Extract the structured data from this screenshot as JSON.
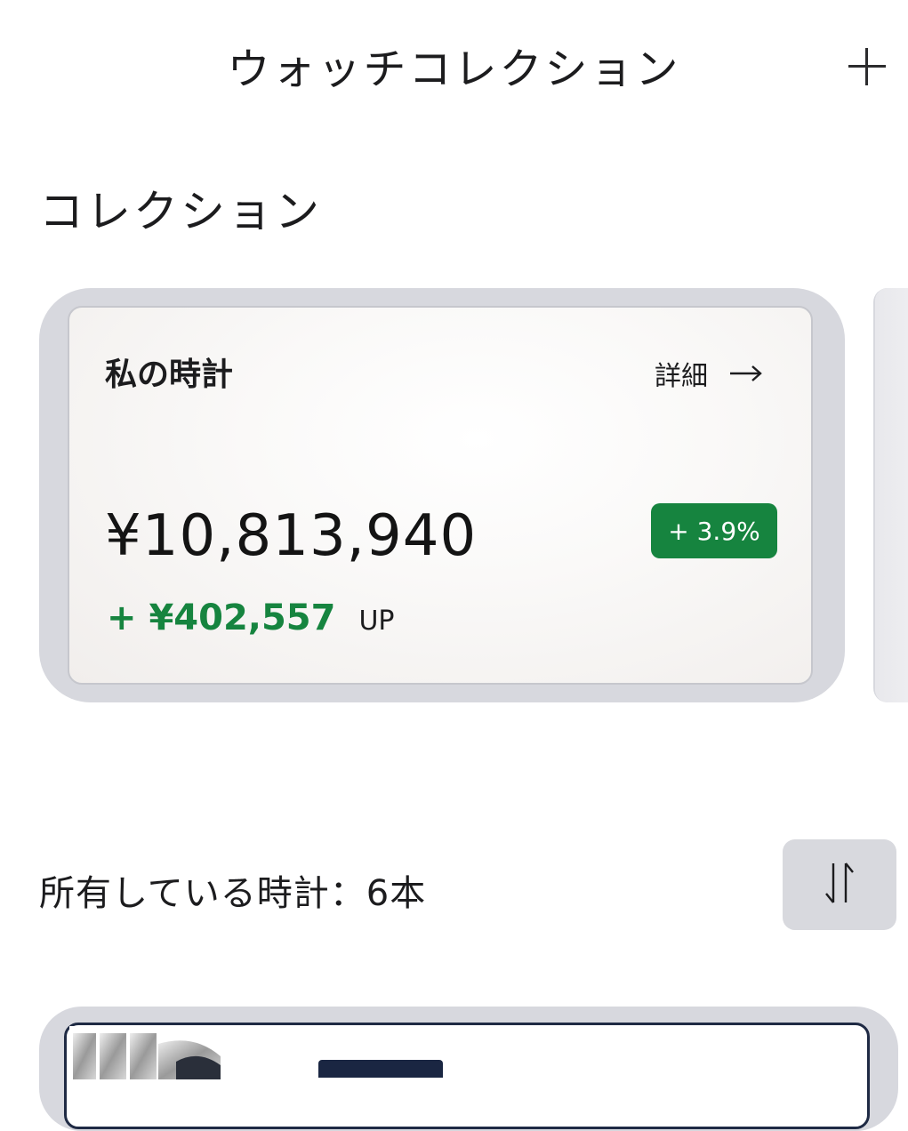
{
  "header": {
    "title": "ウォッチコレクション",
    "add_icon": "plus-icon"
  },
  "section": {
    "title": "コレクション"
  },
  "collection_card": {
    "name": "私の時計",
    "detail_label": "詳細",
    "detail_icon": "arrow-right-icon",
    "total_value": "¥10,813,940",
    "change_percent": "+ 3.9%",
    "change_amount": "+ ¥402,557",
    "change_suffix": "UP",
    "accent_color": "#16843f"
  },
  "owned": {
    "label": "所有している時計：6本",
    "sort_icon": "sort-arrows-icon"
  }
}
